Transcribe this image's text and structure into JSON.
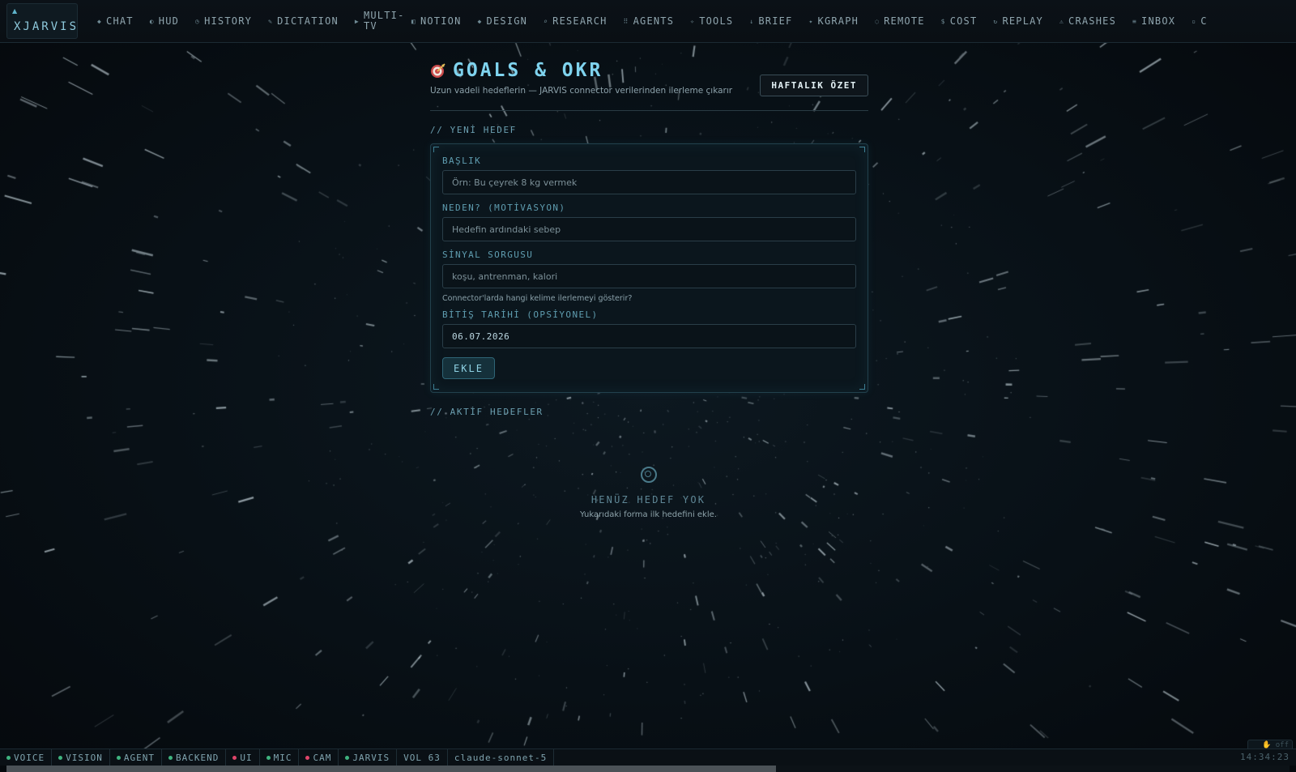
{
  "app": {
    "brand": "XJARVIS"
  },
  "nav": {
    "items": [
      {
        "label": "CHAT",
        "icon": "diamond-icon",
        "glyph": "◆"
      },
      {
        "label": "HUD",
        "icon": "half-circle-icon",
        "glyph": "◐"
      },
      {
        "label": "HISTORY",
        "icon": "clock-icon",
        "glyph": "◷"
      },
      {
        "label": "DICTATION",
        "icon": "pen-icon",
        "glyph": "✎"
      },
      {
        "label": "MULTI-TV",
        "icon": "play-icon",
        "glyph": "▶"
      },
      {
        "label": "NOTION",
        "icon": "notion-icon",
        "glyph": "◧"
      },
      {
        "label": "DESIGN",
        "icon": "design-icon",
        "glyph": "◆"
      },
      {
        "label": "RESEARCH",
        "icon": "magnifier-icon",
        "glyph": "⌕"
      },
      {
        "label": "AGENTS",
        "icon": "grid-icon",
        "glyph": "⠿"
      },
      {
        "label": "TOOLS",
        "icon": "tools-icon",
        "glyph": "✧"
      },
      {
        "label": "BRIEF",
        "icon": "arrow-down-icon",
        "glyph": "↓"
      },
      {
        "label": "KGRAPH",
        "icon": "graph-icon",
        "glyph": "✦"
      },
      {
        "label": "REMOTE",
        "icon": "remote-icon",
        "glyph": "◌"
      },
      {
        "label": "COST",
        "icon": "dollar-icon",
        "glyph": "$"
      },
      {
        "label": "REPLAY",
        "icon": "replay-icon",
        "glyph": "↻"
      },
      {
        "label": "CRASHES",
        "icon": "warning-icon",
        "glyph": "⚠"
      },
      {
        "label": "INBOX",
        "icon": "inbox-icon",
        "glyph": "≡"
      },
      {
        "label": "C",
        "icon": "square-icon",
        "glyph": "▫"
      }
    ]
  },
  "header": {
    "title": "GOALS & OKR",
    "subtitle": "Uzun vadeli hedeflerin — JARVIS connector verilerinden ilerleme çıkarır",
    "weekly_button": "HAFTALIK ÖZET"
  },
  "new_goal": {
    "section_label": "// YENİ HEDEF",
    "title_label": "BAŞLIK",
    "title_placeholder": "Örn: Bu çeyrek 8 kg vermek",
    "why_label": "NEDEN? (MOTİVASYON)",
    "why_placeholder": "Hedefin ardındaki sebep",
    "signal_label": "SİNYAL SORGUSU",
    "signal_placeholder": "koşu, antrenman, kalori",
    "signal_hint": "Connector'larda hangi kelime ilerlemeyi gösterir?",
    "deadline_label": "BİTİŞ TARİHİ (OPSİYONEL)",
    "deadline_value": "06.07.2026",
    "add_button": "EKLE"
  },
  "active_goals": {
    "section_label": "// AKTİF HEDEFLER",
    "empty_title": "HENÜZ HEDEF YOK",
    "empty_subtitle": "Yukarıdaki forma ilk hedefini ekle."
  },
  "status": {
    "items": [
      {
        "label": "VOICE",
        "color": "#3fb37f"
      },
      {
        "label": "VISION",
        "color": "#3fb37f"
      },
      {
        "label": "AGENT",
        "color": "#3fb37f"
      },
      {
        "label": "BACKEND",
        "color": "#3fb37f"
      },
      {
        "label": "UI",
        "color": "#e0456a"
      },
      {
        "label": "MIC",
        "color": "#3fb37f"
      },
      {
        "label": "CAM",
        "color": "#e0456a"
      },
      {
        "label": "JARVIS",
        "color": "#3fb37f"
      }
    ],
    "volume": "VOL 63",
    "model": "claude-sonnet-5",
    "clock": "14:34:23",
    "badge": "off",
    "progress": 0.6
  },
  "colors": {
    "accent": "#7fd3ee",
    "online": "#3fb37f",
    "offline": "#e0456a"
  }
}
